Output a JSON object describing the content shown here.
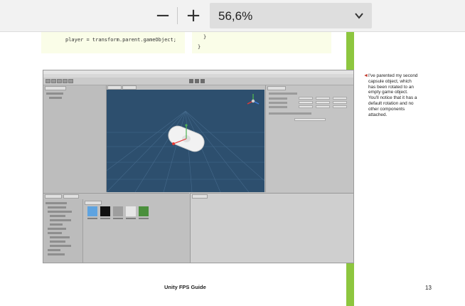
{
  "toolbar": {
    "zoom_out_label": "−",
    "zoom_in_label": "+",
    "zoom_value": "56,6%"
  },
  "document": {
    "code_left_line": "player = transform.parent.gameObject;",
    "code_right_line": "}",
    "caption": "I've parented my second capsule object, which has been rotated to an empty game object. You'll notice that it has a default rotation and no other components attached.",
    "footer_title": "Unity FPS Guide",
    "page_number": "13"
  },
  "colors": {
    "accent_green": "#8dc63f",
    "bullet_red": "#c0392b",
    "scene_blue": "#2d4f6e"
  },
  "icons": [
    "minus-icon",
    "plus-icon",
    "chevron-down-icon",
    "arrow-bullet-icon"
  ]
}
